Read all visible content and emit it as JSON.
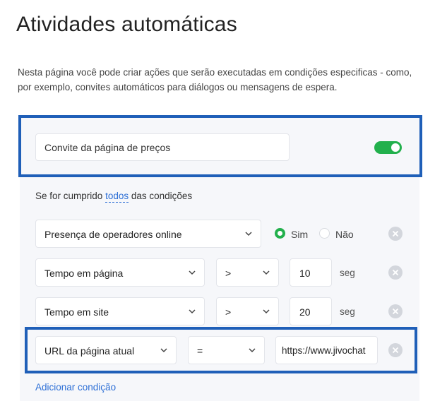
{
  "page": {
    "title": "Atividades automáticas",
    "description": "Nesta página você pode criar ações que serão executadas em condições especificas - como, por exemplo, convites automáticos para diálogos ou mensagens de espera."
  },
  "rule": {
    "name": "Convite da página de preços",
    "enabled": true,
    "toggle_color": "#22b04c"
  },
  "conditions_header": {
    "prefix": "Se for cumprido",
    "link": "todos",
    "suffix": "das condições"
  },
  "conditions": [
    {
      "field": "Presença de operadores online",
      "option_yes": "Sim",
      "option_no": "Não",
      "selected": "Sim"
    },
    {
      "field": "Tempo em página",
      "operator": ">",
      "value": "10",
      "unit": "seg"
    },
    {
      "field": "Tempo em site",
      "operator": ">",
      "value": "20",
      "unit": "seg"
    },
    {
      "field": "URL da página atual",
      "operator": "=",
      "value": "https://www.jivochat"
    }
  ],
  "add_condition_label": "Adicionar condição",
  "colors": {
    "highlight": "#1f5fb8",
    "link": "#2d6fd6",
    "accent_green": "#22b04c",
    "panel_bg": "#f6f7fa"
  },
  "icons": [
    "chevron-down-icon",
    "remove-icon"
  ]
}
